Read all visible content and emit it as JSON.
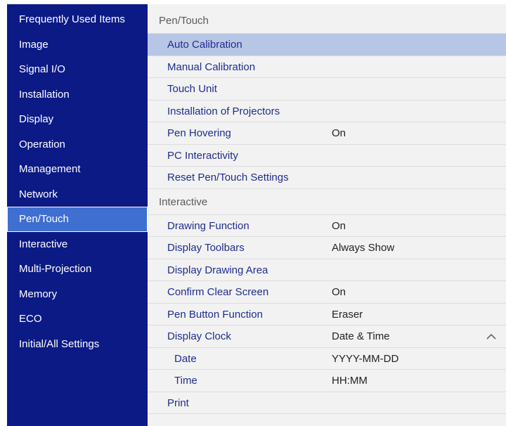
{
  "sidebar": {
    "items": [
      {
        "label": "Frequently Used Items"
      },
      {
        "label": "Image"
      },
      {
        "label": "Signal I/O"
      },
      {
        "label": "Installation"
      },
      {
        "label": "Display"
      },
      {
        "label": "Operation"
      },
      {
        "label": "Management"
      },
      {
        "label": "Network"
      },
      {
        "label": "Pen/Touch"
      },
      {
        "label": "Interactive"
      },
      {
        "label": "Multi-Projection"
      },
      {
        "label": "Memory"
      },
      {
        "label": "ECO"
      },
      {
        "label": "Initial/All Settings"
      }
    ],
    "selected_index": 8
  },
  "pen_touch": {
    "header": "Pen/Touch",
    "rows": [
      {
        "label": "Auto Calibration",
        "value": ""
      },
      {
        "label": "Manual Calibration",
        "value": ""
      },
      {
        "label": "Touch Unit",
        "value": ""
      },
      {
        "label": "Installation of Projectors",
        "value": ""
      },
      {
        "label": "Pen Hovering",
        "value": "On"
      },
      {
        "label": "PC Interactivity",
        "value": ""
      },
      {
        "label": "Reset Pen/Touch Settings",
        "value": ""
      }
    ]
  },
  "interactive": {
    "header": "Interactive",
    "rows": [
      {
        "label": "Drawing Function",
        "value": "On"
      },
      {
        "label": "Display Toolbars",
        "value": "Always Show"
      },
      {
        "label": "Display Drawing Area",
        "value": ""
      },
      {
        "label": "Confirm Clear Screen",
        "value": "On"
      },
      {
        "label": "Pen Button Function",
        "value": "Eraser"
      },
      {
        "label": "Display Clock",
        "value": "Date & Time"
      },
      {
        "label": "Date",
        "value": "YYYY-MM-DD"
      },
      {
        "label": "Time",
        "value": "HH:MM"
      },
      {
        "label": "Print",
        "value": ""
      }
    ]
  },
  "icons": {
    "expand": "chevron-up-icon"
  },
  "colors": {
    "sidebar_bg": "#0c1a86",
    "sidebar_selected": "#3f6fd0",
    "row_selected": "#b8c6e6",
    "label_text": "#1f2d8e"
  }
}
